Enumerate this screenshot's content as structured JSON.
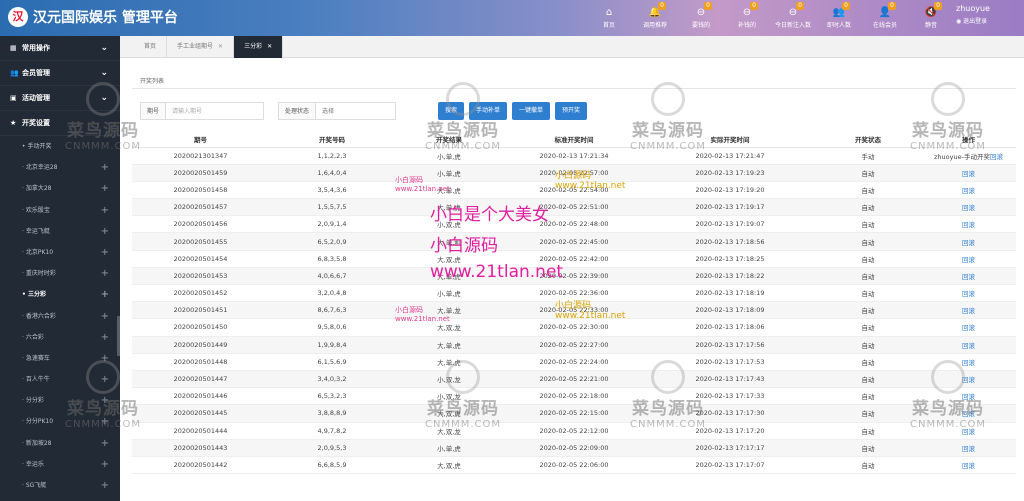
{
  "header": {
    "title": "汉元国际娱乐 管理平台",
    "logo_glyph": "汉",
    "nav": [
      {
        "label": "首页",
        "badge": "",
        "icon": "home-icon",
        "glyph": "⌂"
      },
      {
        "label": "调用推荐",
        "badge": "0",
        "icon": "bell-icon",
        "glyph": "🔔"
      },
      {
        "label": "要钱的",
        "badge": "0",
        "icon": "minus-circle-icon",
        "glyph": "⊖"
      },
      {
        "label": "补钱的",
        "badge": "0",
        "icon": "minus-circle-icon",
        "glyph": "⊖"
      },
      {
        "label": "今日新注入数",
        "badge": "0",
        "icon": "minus-circle-icon",
        "glyph": "⊖"
      },
      {
        "label": "即时人数",
        "badge": "0",
        "icon": "users-icon",
        "glyph": "👥"
      },
      {
        "label": "在线会员",
        "badge": "0",
        "icon": "user-icon",
        "glyph": "👤"
      },
      {
        "label": "静音",
        "badge": "0",
        "icon": "mute-icon",
        "glyph": "🔇"
      }
    ],
    "user_name": "zhuoyue",
    "logout_label": "◉ 退出登录"
  },
  "sidebar": {
    "groups": [
      {
        "label": "常用操作",
        "icon": "dashboard-icon",
        "glyph": "▦"
      },
      {
        "label": "会员管理",
        "icon": "users-icon",
        "glyph": "👥"
      },
      {
        "label": "活动管理",
        "icon": "calendar-icon",
        "glyph": "▣"
      },
      {
        "label": "开奖设置",
        "icon": "star-icon",
        "glyph": "★"
      }
    ],
    "items": [
      {
        "label": "手动开奖",
        "active": false
      },
      {
        "label": "北京幸运28",
        "active": false
      },
      {
        "label": "加拿大28",
        "active": false
      },
      {
        "label": "欢乐骰宝",
        "active": false
      },
      {
        "label": "幸运飞艇",
        "active": false
      },
      {
        "label": "北京PK10",
        "active": false
      },
      {
        "label": "重庆时时彩",
        "active": false
      },
      {
        "label": "三分彩",
        "active": true
      },
      {
        "label": "香港六合彩",
        "active": false
      },
      {
        "label": "六合彩",
        "active": false
      },
      {
        "label": "急速赛车",
        "active": false
      },
      {
        "label": "百人牛牛",
        "active": false
      },
      {
        "label": "分分彩",
        "active": false
      },
      {
        "label": "分分PK10",
        "active": false
      },
      {
        "label": "新加坡28",
        "active": false
      },
      {
        "label": "幸运乐",
        "active": false
      },
      {
        "label": "SG飞艇",
        "active": false
      }
    ]
  },
  "tabs": [
    {
      "label": "首页",
      "closable": false,
      "active": false
    },
    {
      "label": "手工业组期号",
      "closable": true,
      "active": false
    },
    {
      "label": "三分彩",
      "closable": true,
      "active": true
    }
  ],
  "main": {
    "section_title": "开奖列表",
    "filters": {
      "period_label": "期号",
      "period_placeholder": "请输入期号",
      "status_label": "处理状态",
      "status_value": "选择"
    },
    "buttons": {
      "search": "搜索",
      "manual": "手动补单",
      "oneclick": "一键撤单",
      "preset": "预开奖"
    }
  },
  "table": {
    "headers": [
      "期号",
      "开奖号码",
      "开奖结果",
      "标准开奖时间",
      "实际开奖时间",
      "开奖状态",
      "操作"
    ],
    "rows": [
      {
        "period": "2020021301347",
        "nums": "1,1,2,2,3",
        "result": "小,单,虎",
        "std": "2020-02-13 17:21:34",
        "act": "2020-02-13 17:21:47",
        "status": "手动",
        "op_prefix": "zhuoyue-手动开奖",
        "op": "回滚"
      },
      {
        "period": "2020020501459",
        "nums": "1,6,4,0,4",
        "result": "小,单,虎",
        "std": "2020-02-05 22:57:00",
        "act": "2020-02-13 17:19:23",
        "status": "自动",
        "op_prefix": "",
        "op": "回滚"
      },
      {
        "period": "2020020501458",
        "nums": "3,5,4,3,6",
        "result": "大,单,虎",
        "std": "2020-02-05 22:54:00",
        "act": "2020-02-13 17:19:20",
        "status": "自动",
        "op_prefix": "",
        "op": "回滚"
      },
      {
        "period": "2020020501457",
        "nums": "1,5,5,7,5",
        "result": "大,单,虎",
        "std": "2020-02-05 22:51:00",
        "act": "2020-02-13 17:19:17",
        "status": "自动",
        "op_prefix": "",
        "op": "回滚"
      },
      {
        "period": "2020020501456",
        "nums": "2,0,9,1,4",
        "result": "小,双,虎",
        "std": "2020-02-05 22:48:00",
        "act": "2020-02-13 17:19:07",
        "status": "自动",
        "op_prefix": "",
        "op": "回滚"
      },
      {
        "period": "2020020501455",
        "nums": "6,5,2,0,9",
        "result": "大,单,和",
        "std": "2020-02-05 22:45:00",
        "act": "2020-02-13 17:18:56",
        "status": "自动",
        "op_prefix": "",
        "op": "回滚"
      },
      {
        "period": "2020020501454",
        "nums": "6,8,3,5,8",
        "result": "大,双,虎",
        "std": "2020-02-05 22:42:00",
        "act": "2020-02-13 17:18:25",
        "status": "自动",
        "op_prefix": "",
        "op": "回滚"
      },
      {
        "period": "2020020501453",
        "nums": "4,0,6,6,7",
        "result": "大,单,虎",
        "std": "2020-02-05 22:39:00",
        "act": "2020-02-13 17:18:22",
        "status": "自动",
        "op_prefix": "",
        "op": "回滚"
      },
      {
        "period": "2020020501452",
        "nums": "3,2,0,4,8",
        "result": "小,单,虎",
        "std": "2020-02-05 22:36:00",
        "act": "2020-02-13 17:18:19",
        "status": "自动",
        "op_prefix": "",
        "op": "回滚"
      },
      {
        "period": "2020020501451",
        "nums": "8,6,7,6,3",
        "result": "大,单,龙",
        "std": "2020-02-05 22:33:00",
        "act": "2020-02-13 17:18:09",
        "status": "自动",
        "op_prefix": "",
        "op": "回滚"
      },
      {
        "period": "2020020501450",
        "nums": "9,5,8,0,6",
        "result": "大,双,龙",
        "std": "2020-02-05 22:30:00",
        "act": "2020-02-13 17:18:06",
        "status": "自动",
        "op_prefix": "",
        "op": "回滚"
      },
      {
        "period": "2020020501449",
        "nums": "1,9,9,8,4",
        "result": "大,单,虎",
        "std": "2020-02-05 22:27:00",
        "act": "2020-02-13 17:17:56",
        "status": "自动",
        "op_prefix": "",
        "op": "回滚"
      },
      {
        "period": "2020020501448",
        "nums": "6,1,5,6,9",
        "result": "大,单,虎",
        "std": "2020-02-05 22:24:00",
        "act": "2020-02-13 17:17:53",
        "status": "自动",
        "op_prefix": "",
        "op": "回滚"
      },
      {
        "period": "2020020501447",
        "nums": "3,4,0,3,2",
        "result": "小,双,龙",
        "std": "2020-02-05 22:21:00",
        "act": "2020-02-13 17:17:43",
        "status": "自动",
        "op_prefix": "",
        "op": "回滚"
      },
      {
        "period": "2020020501446",
        "nums": "6,5,3,2,3",
        "result": "小,双,龙",
        "std": "2020-02-05 22:18:00",
        "act": "2020-02-13 17:17:33",
        "status": "自动",
        "op_prefix": "",
        "op": "回滚"
      },
      {
        "period": "2020020501445",
        "nums": "3,8,8,8,9",
        "result": "大,双,虎",
        "std": "2020-02-05 22:15:00",
        "act": "2020-02-13 17:17:30",
        "status": "自动",
        "op_prefix": "",
        "op": "回滚"
      },
      {
        "period": "2020020501444",
        "nums": "4,9,7,8,2",
        "result": "大,双,龙",
        "std": "2020-02-05 22:12:00",
        "act": "2020-02-13 17:17:20",
        "status": "自动",
        "op_prefix": "",
        "op": "回滚"
      },
      {
        "period": "2020020501443",
        "nums": "2,0,9,5,3",
        "result": "小,单,虎",
        "std": "2020-02-05 22:09:00",
        "act": "2020-02-13 17:17:17",
        "status": "自动",
        "op_prefix": "",
        "op": "回滚"
      },
      {
        "period": "2020020501442",
        "nums": "6,6,8,5,9",
        "result": "大,双,虎",
        "std": "2020-02-05 22:06:00",
        "act": "2020-02-13 17:17:07",
        "status": "自动",
        "op_prefix": "",
        "op": "回滚"
      }
    ]
  },
  "watermarks": {
    "cn": "菜鸟源码",
    "en": "CNMMM.COM",
    "yellow": "小白源码",
    "yellow_url": "www.21tlan.net",
    "pink": "小白源码",
    "pink_url": "www.21tlan.net",
    "big_line1": "小白是个大美女",
    "big_line2": "小白源码",
    "big_line3": "www.21tlan.net"
  }
}
